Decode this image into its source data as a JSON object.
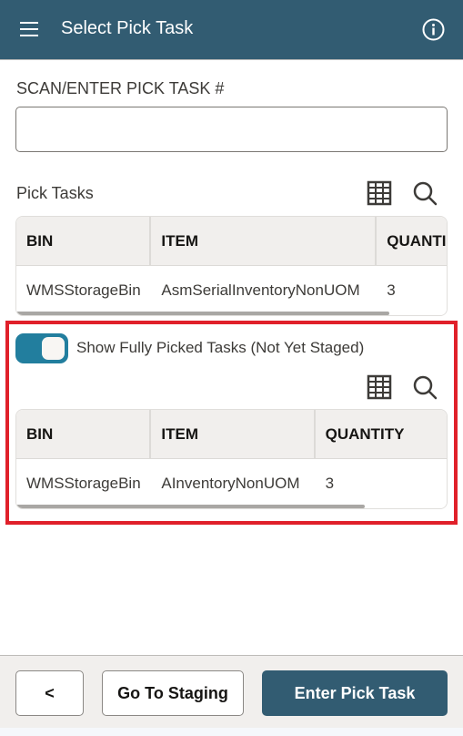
{
  "header": {
    "title": "Select Pick Task",
    "menu_icon": "hamburger-menu-icon",
    "info_icon": "info-circle-icon"
  },
  "scan": {
    "label": "SCAN/ENTER PICK TASK #",
    "value": "",
    "placeholder": ""
  },
  "pick_tasks": {
    "title": "Pick Tasks",
    "icons": [
      "grid-view-icon",
      "search-icon"
    ],
    "columns": [
      "BIN",
      "ITEM",
      "QUANTI"
    ],
    "rows": [
      {
        "bin": "WMSStorageBin",
        "item": "AsmSerialInventoryNonUOM",
        "quantity": "3"
      }
    ]
  },
  "fully_picked": {
    "toggle_label": "Show Fully Picked Tasks (Not Yet Staged)",
    "toggle_on": true,
    "icons": [
      "grid-view-icon",
      "search-icon"
    ],
    "columns": [
      "BIN",
      "ITEM",
      "QUANTITY"
    ],
    "rows": [
      {
        "bin": "WMSStorageBin",
        "item": "AInventoryNonUOM",
        "quantity": "3"
      }
    ]
  },
  "colors": {
    "header_bg": "#325c72",
    "toggle_on": "#227e9e",
    "highlight_border": "#e0202a",
    "primary_button": "#325c72"
  },
  "footer": {
    "back_label": "<",
    "staging_label": "Go To Staging",
    "enter_label": "Enter Pick Task"
  }
}
